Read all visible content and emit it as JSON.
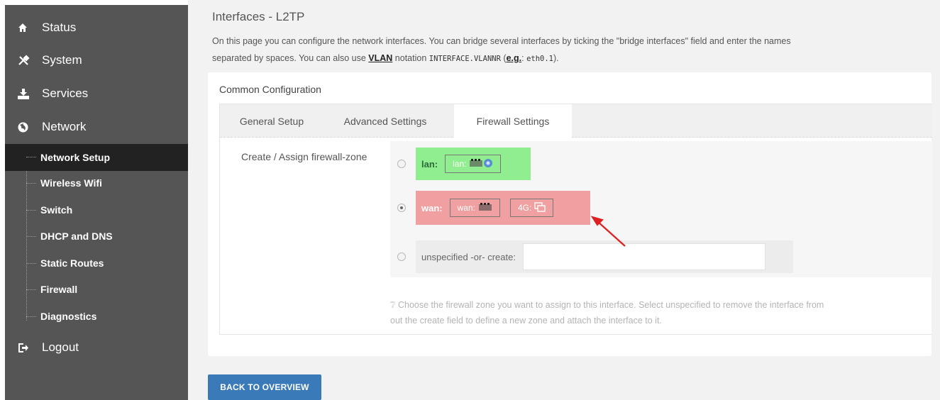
{
  "sidebar": {
    "top_items": [
      {
        "label": "Status",
        "icon": "home-icon"
      },
      {
        "label": "System",
        "icon": "wrench-icon"
      },
      {
        "label": "Services",
        "icon": "download-icon"
      },
      {
        "label": "Network",
        "icon": "globe-icon"
      }
    ],
    "network_items": [
      {
        "label": "Network Setup",
        "active": true
      },
      {
        "label": "Wireless Wifi"
      },
      {
        "label": "Switch"
      },
      {
        "label": "DHCP and DNS"
      },
      {
        "label": "Static Routes"
      },
      {
        "label": "Firewall"
      },
      {
        "label": "Diagnostics"
      }
    ],
    "logout_label": "Logout"
  },
  "page": {
    "title": "Interfaces - L2TP",
    "desc_part1": "On this page you can configure the network interfaces. You can bridge several interfaces by ticking the \"bridge interfaces\" field and enter the names",
    "desc_part2": "separated by spaces. You can also use ",
    "desc_vlan": "VLAN",
    "desc_part3": " notation ",
    "desc_code": "INTERFACE.VLANNR",
    "desc_paren_open": " (",
    "desc_eg": "e.g.",
    "desc_colon": ": ",
    "desc_code2": "eth0.1",
    "desc_paren_close": ")."
  },
  "card": {
    "title": "Common Configuration",
    "tabs": [
      "General Setup",
      "Advanced Settings",
      "Firewall Settings"
    ],
    "active_tab": "Firewall Settings",
    "field_label": "Create / Assign firewall-zone",
    "zones": {
      "lan": {
        "name": "lan:",
        "networks": [
          {
            "label": "lan:",
            "icon": "ethernet-wifi-icon"
          }
        ],
        "color": "#90ee90",
        "selected": false
      },
      "wan": {
        "name": "wan:",
        "networks": [
          {
            "label": "wan:",
            "icon": "ethernet-icon"
          },
          {
            "label": "4G:",
            "icon": "modem-icon"
          }
        ],
        "color": "#f0a0a0",
        "selected": true
      }
    },
    "unspecified_label": "unspecified -or- create:",
    "unspecified_value": "",
    "help_text": "Choose the firewall zone you want to assign to this interface. Select unspecified to remove the interface from",
    "help_text2": "out the create field to define a new zone and attach the interface to it."
  },
  "back_button": "BACK TO OVERVIEW",
  "colors": {
    "sidebar_bg": "#555555",
    "active_bg": "#222222",
    "button": "#3a7ab8",
    "arrow": "#e02020"
  }
}
